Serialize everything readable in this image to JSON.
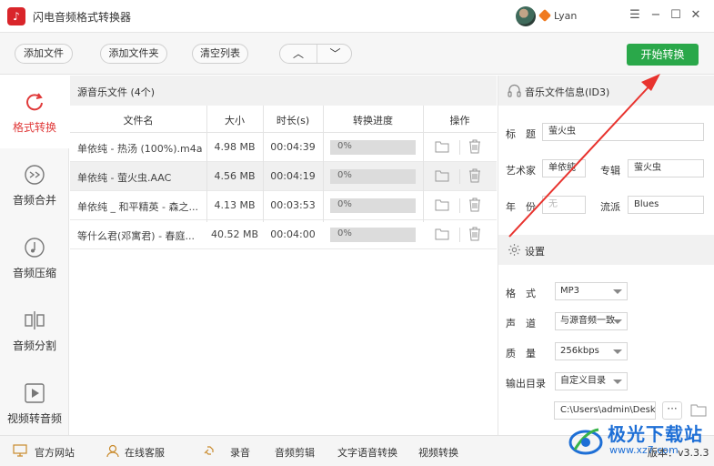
{
  "window": {
    "title": "闪电音频格式转换器",
    "user_name": "Lyan"
  },
  "toolbar": {
    "add_file": "添加文件",
    "add_folder": "添加文件夹",
    "clear_list": "清空列表",
    "move_up": "︿",
    "move_down": "﹀",
    "start_convert": "开始转换"
  },
  "sidebar": {
    "items": [
      {
        "label": "格式转换",
        "icon": "refresh-icon",
        "active": true
      },
      {
        "label": "音频合并",
        "icon": "merge-icon",
        "active": false
      },
      {
        "label": "音频压缩",
        "icon": "music-note-icon",
        "active": false
      },
      {
        "label": "音频分割",
        "icon": "split-icon",
        "active": false
      },
      {
        "label": "视频转音频",
        "icon": "play-icon",
        "active": false
      }
    ]
  },
  "file_table": {
    "title": "源音乐文件 (4个)",
    "columns": [
      "文件名",
      "大小",
      "时长(s)",
      "转换进度",
      "操作"
    ],
    "rows": [
      {
        "name": "单依纯 - 热汤 (100%).m4a",
        "size": "4.98 MB",
        "duration": "00:04:39",
        "progress": "0%"
      },
      {
        "name": "单依纯 - 萤火虫.AAC",
        "size": "4.56 MB",
        "duration": "00:04:19",
        "progress": "0%"
      },
      {
        "name": "单依纯 _ 和平精英 - 森之...",
        "size": "4.13 MB",
        "duration": "00:03:53",
        "progress": "0%"
      },
      {
        "name": "等什么君(邓寓君) - 春庭...",
        "size": "40.52 MB",
        "duration": "00:04:00",
        "progress": "0%"
      }
    ]
  },
  "id3_panel": {
    "title": "音乐文件信息(ID3)",
    "title_label": "标　题",
    "title_value": "萤火虫",
    "artist_label": "艺术家",
    "artist_value": "单依纯",
    "album_label": "专辑",
    "album_value": "萤火虫",
    "year_label": "年　份",
    "year_value": "无",
    "genre_label": "流派",
    "genre_value": "Blues"
  },
  "settings_panel": {
    "title": "设置",
    "format_label": "格　式",
    "format_value": "MP3",
    "channel_label": "声　道",
    "channel_value": "与源音频一致",
    "quality_label": "质　量",
    "quality_value": "256kbps",
    "output_label": "输出目录",
    "output_value": "自定义目录",
    "path_value": "C:\\Users\\admin\\Desktc",
    "browse_label": "···"
  },
  "footer": {
    "website": "官方网站",
    "support": "在线客服",
    "record": "录音",
    "audio_edit": "音频剪辑",
    "tts": "文字语音转换",
    "video_convert": "视频转换",
    "version": "版本：v3.3.3"
  },
  "watermark": {
    "name": "极光下载站",
    "url": "www.xz7.com"
  },
  "colors": {
    "accent_red": "#e03a3a",
    "start_green": "#2aa84a",
    "annotation_red": "#e8332e",
    "watermark_blue": "#1e6fd6"
  }
}
